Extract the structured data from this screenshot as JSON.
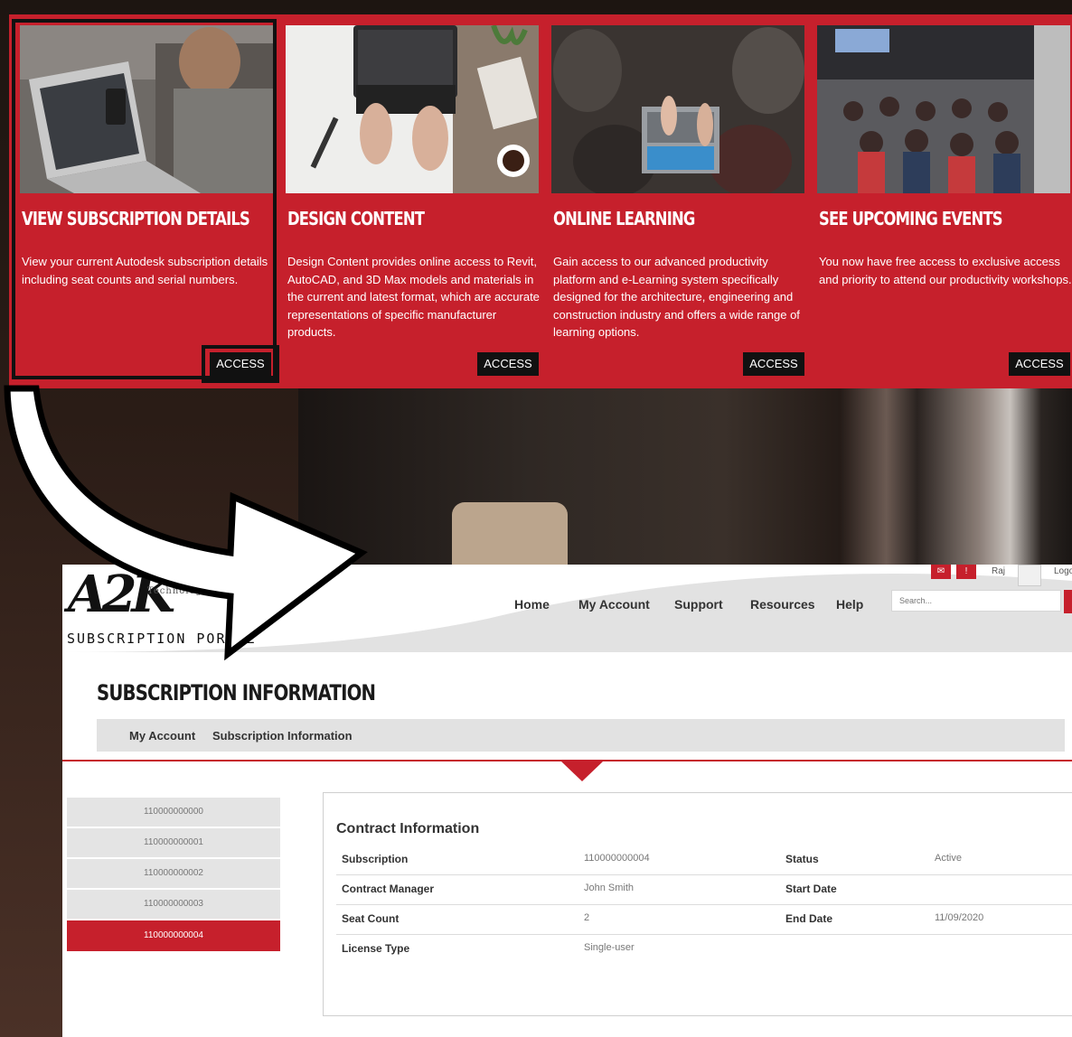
{
  "cards": [
    {
      "title": "VIEW SUBSCRIPTION DETAILS",
      "description": "View your current Autodesk subscription details including seat counts and serial numbers.",
      "button": "ACCESS"
    },
    {
      "title": "DESIGN CONTENT",
      "description": "Design Content provides online access to Revit, AutoCAD, and 3D Max models and materials in the current and latest format, which are accurate representations of specific manufacturer products.",
      "button": "ACCESS"
    },
    {
      "title": "ONLINE LEARNING",
      "description": "Gain access to our advanced productivity platform and e-Learning system specifically designed for the architecture, engineering and construction industry and offers a wide range of learning options.",
      "button": "ACCESS"
    },
    {
      "title": "SEE UPCOMING EVENTS",
      "description": "You now have free access to exclusive access and priority to attend our productivity workshops.",
      "button": "ACCESS"
    }
  ],
  "portal": {
    "logo": {
      "brand": "A2K",
      "tagline": "Technologies",
      "subtitle": "SUBSCRIPTION PORTAL"
    },
    "nav": [
      "Home",
      "My Account",
      "Support",
      "Resources",
      "Help"
    ],
    "search": {
      "placeholder": "Search..."
    },
    "user": {
      "name": "Raj",
      "logout": "Logout"
    },
    "page_title": "SUBSCRIPTION INFORMATION",
    "breadcrumb": [
      "My Account",
      "Subscription Information"
    ],
    "subscriptions": [
      "110000000000",
      "110000000001",
      "110000000002",
      "110000000003",
      "110000000004"
    ],
    "active_subscription": "110000000004",
    "contract": {
      "heading": "Contract Information",
      "rows": [
        {
          "label": "Subscription",
          "value": "110000000004",
          "label2": "Status",
          "value2": "Active"
        },
        {
          "label": "Contract Manager",
          "value": "John Smith",
          "label2": "Start Date",
          "value2": ""
        },
        {
          "label": "Seat Count",
          "value": "2",
          "label2": "End Date",
          "value2": "11/09/2020"
        },
        {
          "label": "License Type",
          "value": "Single-user",
          "label2": "",
          "value2": ""
        }
      ]
    }
  },
  "colors": {
    "brand_red": "#c6202c",
    "dark": "#111111",
    "panel_gray": "#e2e2e2"
  },
  "icons": [
    "mail-icon",
    "notification-icon",
    "user-avatar-icon",
    "search-icon",
    "curved-arrow-icon"
  ]
}
